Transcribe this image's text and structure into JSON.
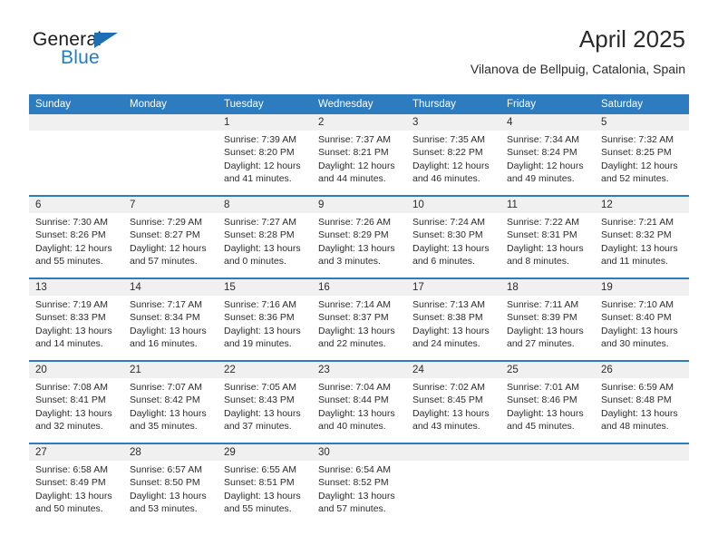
{
  "brand": {
    "name_part1": "General",
    "name_part2": "Blue",
    "triangle_color": "#1f6fb5",
    "blue_color": "#1f7ec4"
  },
  "header": {
    "title": "April 2025",
    "subtitle": "Vilanova de Bellpuig, Catalonia, Spain"
  },
  "theme": {
    "header_bg": "#2d7cbf",
    "daynum_bg": "#f0f0f0",
    "text": "#2b2b2b"
  },
  "weekdays": [
    "Sunday",
    "Monday",
    "Tuesday",
    "Wednesday",
    "Thursday",
    "Friday",
    "Saturday"
  ],
  "weeks": [
    {
      "days": [
        {
          "date": "",
          "lines": [
            "",
            "",
            "",
            ""
          ],
          "empty": true
        },
        {
          "date": "",
          "lines": [
            "",
            "",
            "",
            ""
          ],
          "empty": true
        },
        {
          "date": "1",
          "lines": [
            "Sunrise: 7:39 AM",
            "Sunset: 8:20 PM",
            "Daylight: 12 hours",
            "and 41 minutes."
          ],
          "empty": false
        },
        {
          "date": "2",
          "lines": [
            "Sunrise: 7:37 AM",
            "Sunset: 8:21 PM",
            "Daylight: 12 hours",
            "and 44 minutes."
          ],
          "empty": false
        },
        {
          "date": "3",
          "lines": [
            "Sunrise: 7:35 AM",
            "Sunset: 8:22 PM",
            "Daylight: 12 hours",
            "and 46 minutes."
          ],
          "empty": false
        },
        {
          "date": "4",
          "lines": [
            "Sunrise: 7:34 AM",
            "Sunset: 8:24 PM",
            "Daylight: 12 hours",
            "and 49 minutes."
          ],
          "empty": false
        },
        {
          "date": "5",
          "lines": [
            "Sunrise: 7:32 AM",
            "Sunset: 8:25 PM",
            "Daylight: 12 hours",
            "and 52 minutes."
          ],
          "empty": false
        }
      ]
    },
    {
      "days": [
        {
          "date": "6",
          "lines": [
            "Sunrise: 7:30 AM",
            "Sunset: 8:26 PM",
            "Daylight: 12 hours",
            "and 55 minutes."
          ],
          "empty": false
        },
        {
          "date": "7",
          "lines": [
            "Sunrise: 7:29 AM",
            "Sunset: 8:27 PM",
            "Daylight: 12 hours",
            "and 57 minutes."
          ],
          "empty": false
        },
        {
          "date": "8",
          "lines": [
            "Sunrise: 7:27 AM",
            "Sunset: 8:28 PM",
            "Daylight: 13 hours",
            "and 0 minutes."
          ],
          "empty": false
        },
        {
          "date": "9",
          "lines": [
            "Sunrise: 7:26 AM",
            "Sunset: 8:29 PM",
            "Daylight: 13 hours",
            "and 3 minutes."
          ],
          "empty": false
        },
        {
          "date": "10",
          "lines": [
            "Sunrise: 7:24 AM",
            "Sunset: 8:30 PM",
            "Daylight: 13 hours",
            "and 6 minutes."
          ],
          "empty": false
        },
        {
          "date": "11",
          "lines": [
            "Sunrise: 7:22 AM",
            "Sunset: 8:31 PM",
            "Daylight: 13 hours",
            "and 8 minutes."
          ],
          "empty": false
        },
        {
          "date": "12",
          "lines": [
            "Sunrise: 7:21 AM",
            "Sunset: 8:32 PM",
            "Daylight: 13 hours",
            "and 11 minutes."
          ],
          "empty": false
        }
      ]
    },
    {
      "days": [
        {
          "date": "13",
          "lines": [
            "Sunrise: 7:19 AM",
            "Sunset: 8:33 PM",
            "Daylight: 13 hours",
            "and 14 minutes."
          ],
          "empty": false
        },
        {
          "date": "14",
          "lines": [
            "Sunrise: 7:17 AM",
            "Sunset: 8:34 PM",
            "Daylight: 13 hours",
            "and 16 minutes."
          ],
          "empty": false
        },
        {
          "date": "15",
          "lines": [
            "Sunrise: 7:16 AM",
            "Sunset: 8:36 PM",
            "Daylight: 13 hours",
            "and 19 minutes."
          ],
          "empty": false
        },
        {
          "date": "16",
          "lines": [
            "Sunrise: 7:14 AM",
            "Sunset: 8:37 PM",
            "Daylight: 13 hours",
            "and 22 minutes."
          ],
          "empty": false
        },
        {
          "date": "17",
          "lines": [
            "Sunrise: 7:13 AM",
            "Sunset: 8:38 PM",
            "Daylight: 13 hours",
            "and 24 minutes."
          ],
          "empty": false
        },
        {
          "date": "18",
          "lines": [
            "Sunrise: 7:11 AM",
            "Sunset: 8:39 PM",
            "Daylight: 13 hours",
            "and 27 minutes."
          ],
          "empty": false
        },
        {
          "date": "19",
          "lines": [
            "Sunrise: 7:10 AM",
            "Sunset: 8:40 PM",
            "Daylight: 13 hours",
            "and 30 minutes."
          ],
          "empty": false
        }
      ]
    },
    {
      "days": [
        {
          "date": "20",
          "lines": [
            "Sunrise: 7:08 AM",
            "Sunset: 8:41 PM",
            "Daylight: 13 hours",
            "and 32 minutes."
          ],
          "empty": false
        },
        {
          "date": "21",
          "lines": [
            "Sunrise: 7:07 AM",
            "Sunset: 8:42 PM",
            "Daylight: 13 hours",
            "and 35 minutes."
          ],
          "empty": false
        },
        {
          "date": "22",
          "lines": [
            "Sunrise: 7:05 AM",
            "Sunset: 8:43 PM",
            "Daylight: 13 hours",
            "and 37 minutes."
          ],
          "empty": false
        },
        {
          "date": "23",
          "lines": [
            "Sunrise: 7:04 AM",
            "Sunset: 8:44 PM",
            "Daylight: 13 hours",
            "and 40 minutes."
          ],
          "empty": false
        },
        {
          "date": "24",
          "lines": [
            "Sunrise: 7:02 AM",
            "Sunset: 8:45 PM",
            "Daylight: 13 hours",
            "and 43 minutes."
          ],
          "empty": false
        },
        {
          "date": "25",
          "lines": [
            "Sunrise: 7:01 AM",
            "Sunset: 8:46 PM",
            "Daylight: 13 hours",
            "and 45 minutes."
          ],
          "empty": false
        },
        {
          "date": "26",
          "lines": [
            "Sunrise: 6:59 AM",
            "Sunset: 8:48 PM",
            "Daylight: 13 hours",
            "and 48 minutes."
          ],
          "empty": false
        }
      ]
    },
    {
      "days": [
        {
          "date": "27",
          "lines": [
            "Sunrise: 6:58 AM",
            "Sunset: 8:49 PM",
            "Daylight: 13 hours",
            "and 50 minutes."
          ],
          "empty": false
        },
        {
          "date": "28",
          "lines": [
            "Sunrise: 6:57 AM",
            "Sunset: 8:50 PM",
            "Daylight: 13 hours",
            "and 53 minutes."
          ],
          "empty": false
        },
        {
          "date": "29",
          "lines": [
            "Sunrise: 6:55 AM",
            "Sunset: 8:51 PM",
            "Daylight: 13 hours",
            "and 55 minutes."
          ],
          "empty": false
        },
        {
          "date": "30",
          "lines": [
            "Sunrise: 6:54 AM",
            "Sunset: 8:52 PM",
            "Daylight: 13 hours",
            "and 57 minutes."
          ],
          "empty": false
        },
        {
          "date": "",
          "lines": [
            "",
            "",
            "",
            ""
          ],
          "empty": true
        },
        {
          "date": "",
          "lines": [
            "",
            "",
            "",
            ""
          ],
          "empty": true
        },
        {
          "date": "",
          "lines": [
            "",
            "",
            "",
            ""
          ],
          "empty": true
        }
      ]
    }
  ]
}
